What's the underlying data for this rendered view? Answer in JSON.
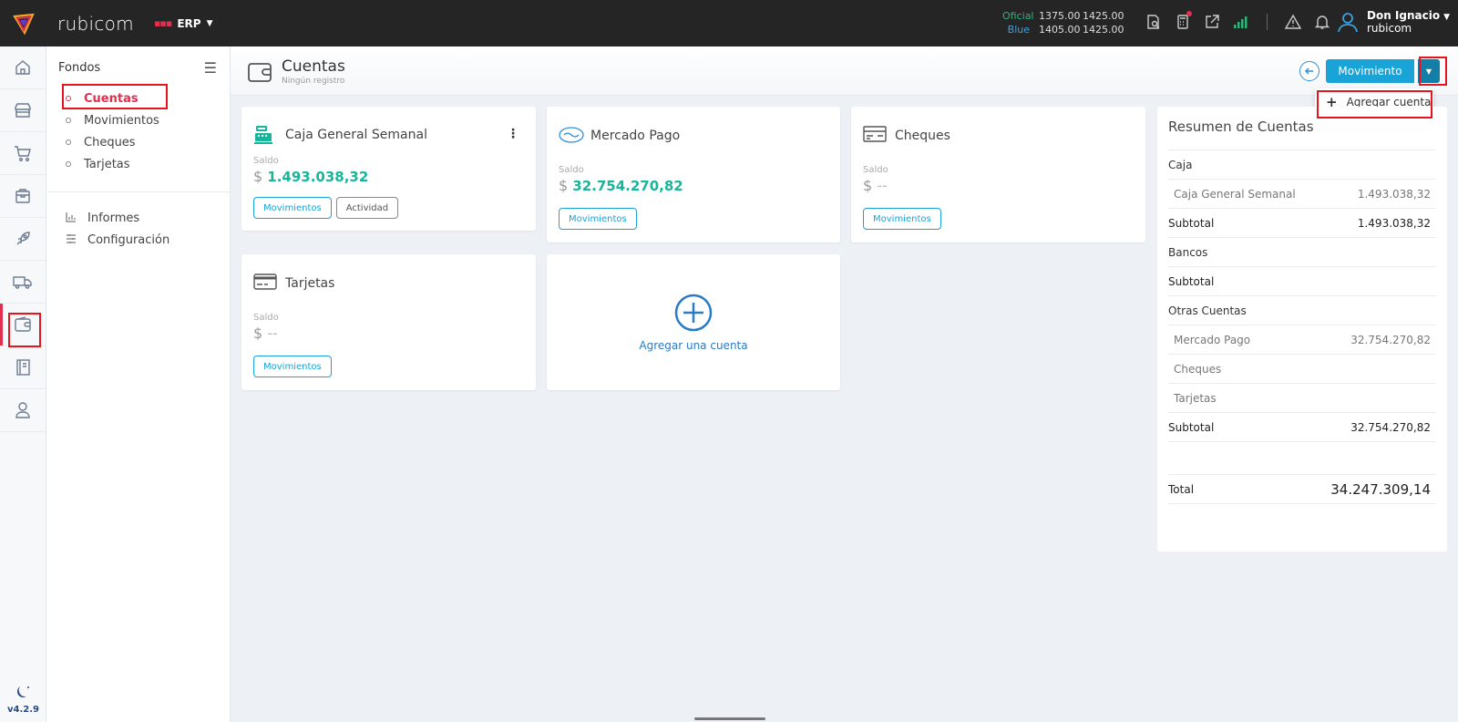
{
  "topbar": {
    "brand": "rubicom",
    "module": "ERP",
    "rates": {
      "oficial_label": "Oficial",
      "oficial_buy": "1375.00",
      "oficial_sell": "1425.00",
      "blue_label": "Blue",
      "blue_buy": "1405.00",
      "blue_sell": "1425.00"
    },
    "user_name": "Don Ignacio",
    "user_company": "rubicom"
  },
  "rail": {
    "version": "v4.2.9"
  },
  "submenu": {
    "title": "Fondos",
    "items": [
      {
        "label": "Cuentas"
      },
      {
        "label": "Movimientos"
      },
      {
        "label": "Cheques"
      },
      {
        "label": "Tarjetas"
      }
    ],
    "extra": [
      {
        "label": "Informes"
      },
      {
        "label": "Configuración"
      }
    ]
  },
  "page": {
    "title": "Cuentas",
    "subtitle": "Ningún registro",
    "movimiento_btn": "Movimiento",
    "dropdown_item": "Agregar cuenta"
  },
  "cards": {
    "caja": {
      "title": "Caja General Semanal",
      "saldo_label": "Saldo",
      "currency": "$",
      "amount": "1.493.038,32",
      "btn1": "Movimientos",
      "btn2": "Actividad"
    },
    "mercado": {
      "title": "Mercado Pago",
      "saldo_label": "Saldo",
      "currency": "$",
      "amount": "32.754.270,82",
      "btn1": "Movimientos"
    },
    "cheques": {
      "title": "Cheques",
      "saldo_label": "Saldo",
      "currency": "$",
      "amount": "--",
      "btn1": "Movimientos"
    },
    "tarjetas": {
      "title": "Tarjetas",
      "saldo_label": "Saldo",
      "currency": "$",
      "amount": "--",
      "btn1": "Movimientos"
    },
    "add": {
      "label": "Agregar una cuenta"
    }
  },
  "summary": {
    "title": "Resumen de Cuentas",
    "caja_group": "Caja",
    "caja_rows": [
      {
        "name": "Caja General Semanal",
        "value": "1.493.038,32"
      }
    ],
    "caja_subtotal_label": "Subtotal",
    "caja_subtotal": "1.493.038,32",
    "bancos_group": "Bancos",
    "bancos_subtotal_label": "Subtotal",
    "otras_group": "Otras Cuentas",
    "otras_rows": [
      {
        "name": "Mercado Pago",
        "value": "32.754.270,82"
      },
      {
        "name": "Cheques",
        "value": ""
      },
      {
        "name": "Tarjetas",
        "value": ""
      }
    ],
    "otras_subtotal_label": "Subtotal",
    "otras_subtotal": "32.754.270,82",
    "total_label": "Total",
    "total": "34.247.309,14"
  },
  "colors": {
    "accent": "#1aa3d6",
    "active": "#e0304e",
    "positive": "#17b69a",
    "annotation": "#e8141d"
  }
}
